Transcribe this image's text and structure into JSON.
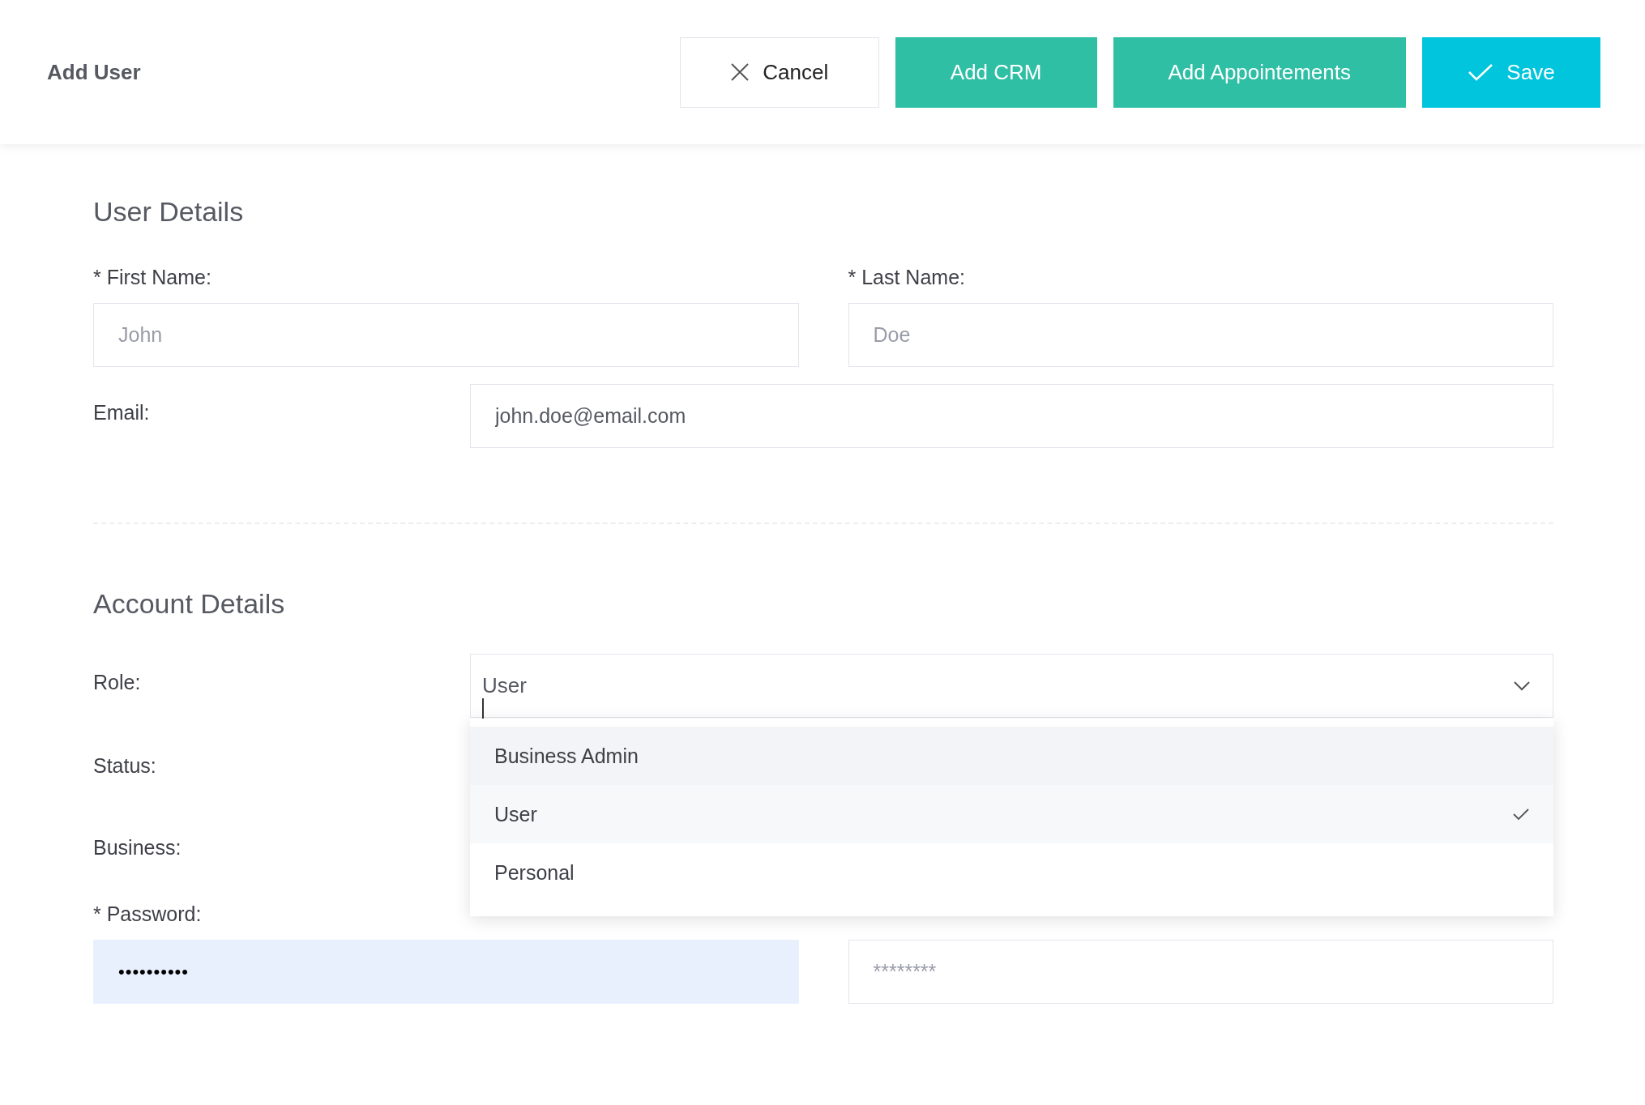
{
  "header": {
    "title": "Add User",
    "buttons": [
      {
        "kind": "cancel",
        "label": "Cancel"
      },
      {
        "kind": "secondary",
        "label": "Add CRM"
      },
      {
        "kind": "secondary",
        "label": "Add Appointements"
      },
      {
        "kind": "primary",
        "label": "Save"
      }
    ]
  },
  "user_details": {
    "heading": "User Details",
    "first_name": {
      "label": "* First Name:",
      "placeholder": "John"
    },
    "last_name": {
      "label": "* Last Name:",
      "placeholder": "Doe"
    },
    "email": {
      "label": "Email:",
      "value": "john.doe@email.com"
    }
  },
  "account_details": {
    "heading": "Account Details",
    "role": {
      "label": "Role:",
      "value": "User",
      "expanded": true,
      "options": [
        {
          "label": "Business Admin",
          "highlighted": true,
          "selected": false
        },
        {
          "label": "User",
          "highlighted": false,
          "selected": true
        },
        {
          "label": "Personal",
          "highlighted": false,
          "selected": false
        }
      ]
    },
    "status": {
      "label": "Status:"
    },
    "business": {
      "label": "Business:"
    },
    "password": {
      "label": "* Password:",
      "value": "••••••••••",
      "autofilled": true
    },
    "confirm_password": {
      "placeholder": "********"
    }
  }
}
